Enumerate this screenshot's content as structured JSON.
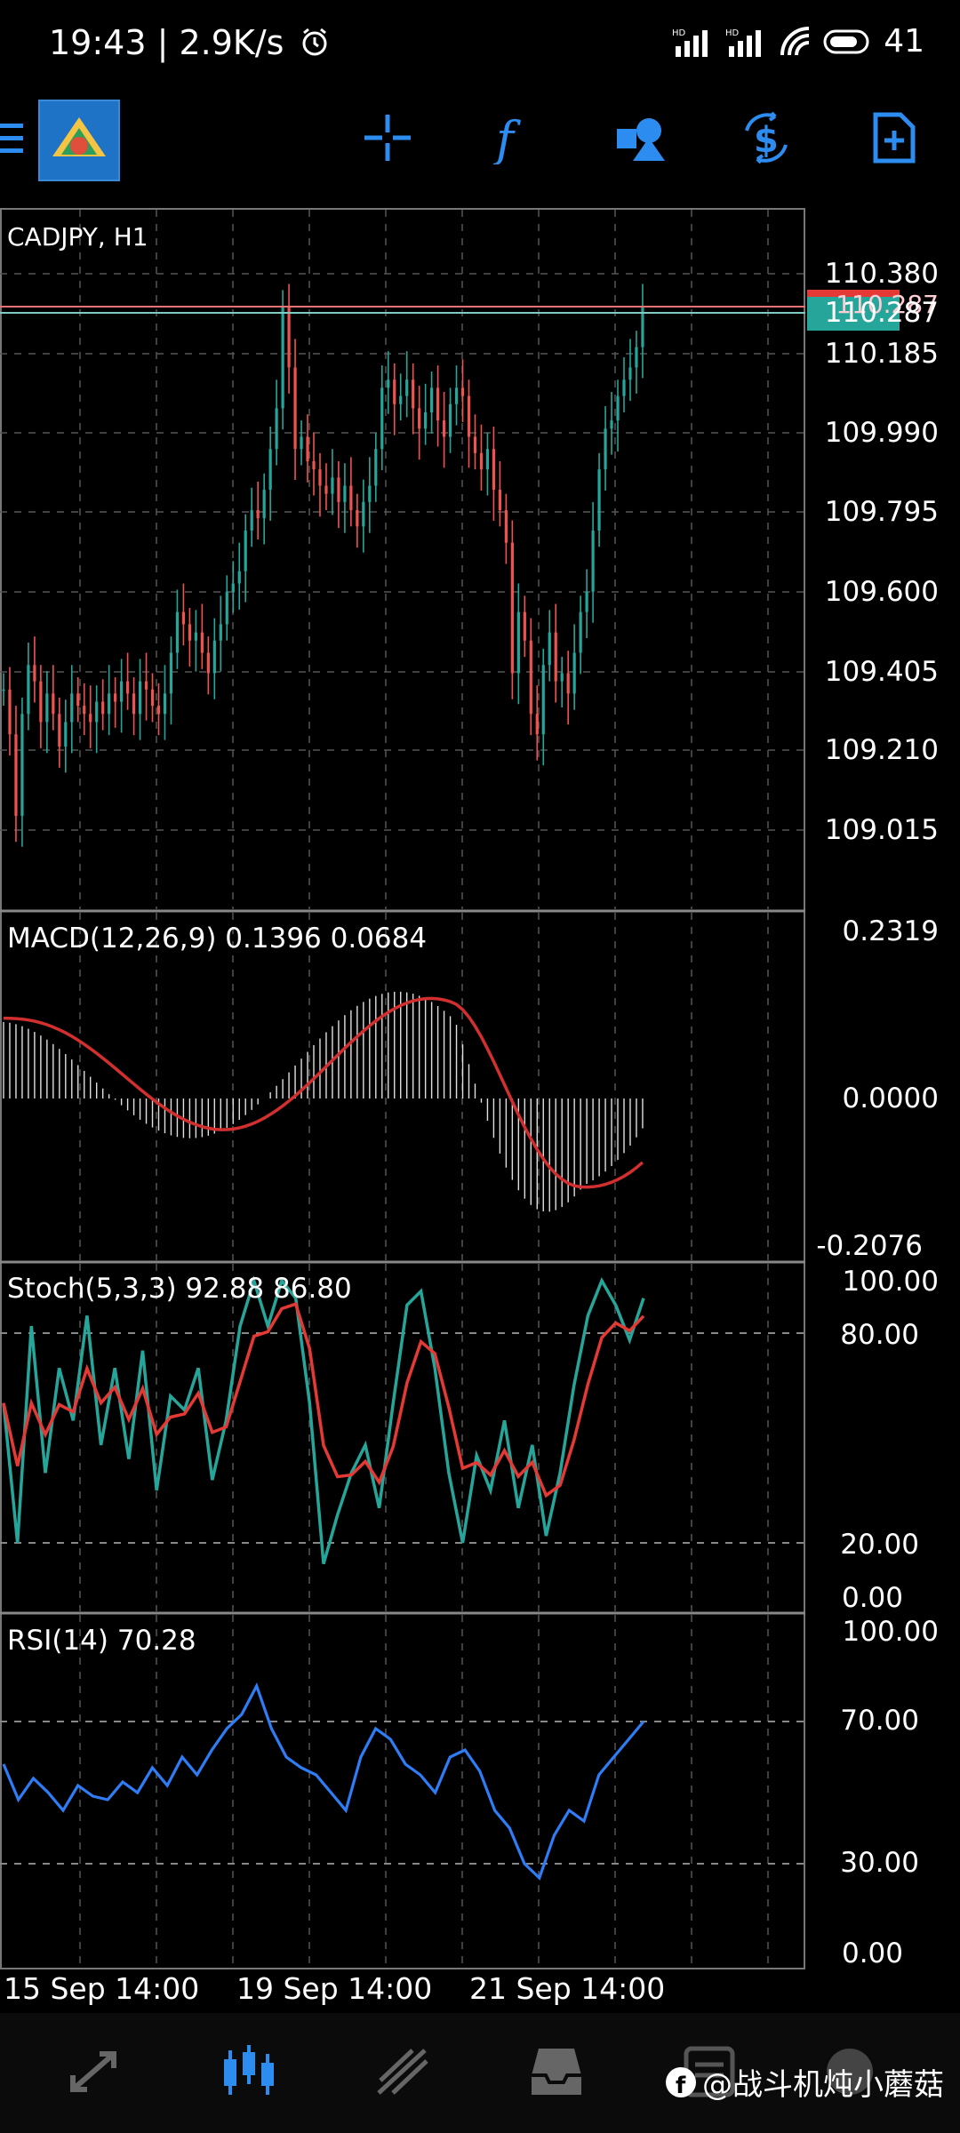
{
  "status_bar": {
    "time": "19:43",
    "net_speed": "| 2.9K/s",
    "signal_labels": [
      "HD",
      "HD"
    ],
    "battery": "41"
  },
  "toolbar": {
    "icons": [
      "menu-icon",
      "app-logo",
      "crosshair-icon",
      "function-icon",
      "objects-icon",
      "trade-icon",
      "new-document-icon"
    ]
  },
  "chart": {
    "symbol": "CADJPY, H1",
    "price_levels": [
      "110.380",
      "110.185",
      "109.990",
      "109.795",
      "109.600",
      "109.405",
      "109.210",
      "109.015"
    ],
    "bid_price": "110.287",
    "ask_price": "110.287",
    "dates": [
      "15 Sep 14:00",
      "19 Sep 14:00",
      "21 Sep 14:00"
    ]
  },
  "macd": {
    "label": "MACD(12,26,9) 0.1396 0.0684",
    "levels": [
      "0.2319",
      "0.0000",
      "-0.2076"
    ]
  },
  "stoch": {
    "label": "Stoch(5,3,3) 92.88 86.80",
    "levels": [
      "100.00",
      "80.00",
      "20.00",
      "0.00"
    ]
  },
  "rsi": {
    "label": "RSI(14) 70.28",
    "levels": [
      "100.00",
      "70.00",
      "30.00",
      "0.00"
    ]
  },
  "bottom_nav": {
    "items": [
      "quotes-icon",
      "chart-icon",
      "trade-icon",
      "history-icon",
      "messages-icon",
      "settings-icon"
    ]
  },
  "watermark": "@战斗机炖小蘑菇",
  "colors": {
    "bull": "#26a69a",
    "bear": "#ef5350",
    "macd_signal": "#d32f2f",
    "stoch_main": "#26a69a",
    "stoch_signal": "#e53935",
    "rsi_line": "#2f7df6",
    "accent": "#2d8cf0"
  }
}
